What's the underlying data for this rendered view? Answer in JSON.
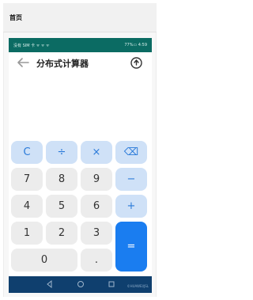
{
  "top_bar": {
    "title": "首页"
  },
  "status_bar": {
    "left": "没有 SIM 卡 ᯤ ᯤ ᯤ",
    "right": "77%▭ 4:59"
  },
  "app_bar": {
    "title": "分布式计算器"
  },
  "keys": [
    {
      "label": "C",
      "name": "clear-key",
      "type": "op"
    },
    {
      "label": "÷",
      "name": "divide-key",
      "type": "op"
    },
    {
      "label": "×",
      "name": "multiply-key",
      "type": "op"
    },
    {
      "label": "⌫",
      "name": "backspace-key",
      "type": "op"
    },
    {
      "label": "7",
      "name": "digit-7-key",
      "type": "num"
    },
    {
      "label": "8",
      "name": "digit-8-key",
      "type": "num"
    },
    {
      "label": "9",
      "name": "digit-9-key",
      "type": "num"
    },
    {
      "label": "−",
      "name": "minus-key",
      "type": "op"
    },
    {
      "label": "4",
      "name": "digit-4-key",
      "type": "num"
    },
    {
      "label": "5",
      "name": "digit-5-key",
      "type": "num"
    },
    {
      "label": "6",
      "name": "digit-6-key",
      "type": "num"
    },
    {
      "label": "+",
      "name": "plus-key",
      "type": "op"
    },
    {
      "label": "1",
      "name": "digit-1-key",
      "type": "num"
    },
    {
      "label": "2",
      "name": "digit-2-key",
      "type": "num"
    },
    {
      "label": "3",
      "name": "digit-3-key",
      "type": "num"
    },
    {
      "label": "=",
      "name": "equals-key",
      "type": "eq"
    },
    {
      "label": "0",
      "name": "digit-0-key",
      "type": "num"
    },
    {
      "label": ".",
      "name": "decimal-key",
      "type": "num"
    }
  ],
  "nav_bar": {
    "watermark": "©HUAWEI/JSL"
  },
  "colors": {
    "status": "#0b6b63",
    "accent": "#1a7df0",
    "operator_bg": "#cfe1f7",
    "key_bg": "#ececec",
    "nav": "#0f3f6e"
  },
  "icons": {
    "back": "arrow-left-icon",
    "share": "device-transfer-icon"
  }
}
